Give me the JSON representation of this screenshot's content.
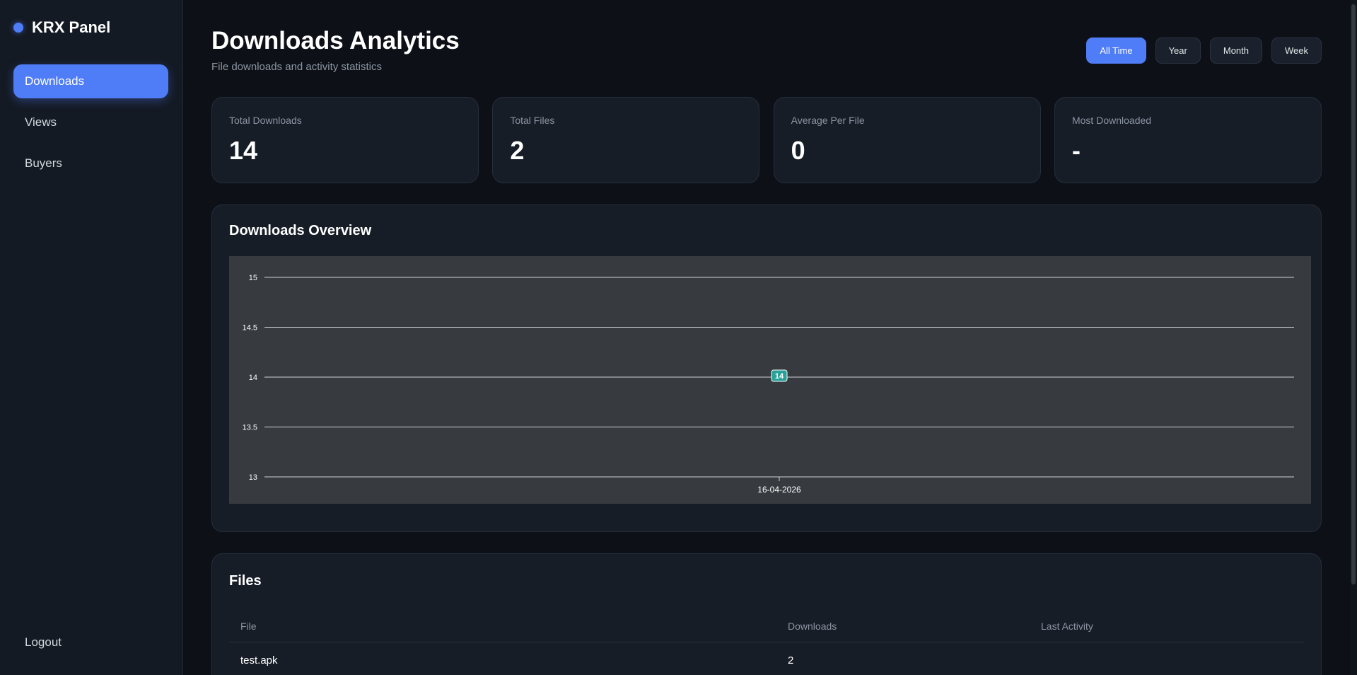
{
  "brand": {
    "title": "KRX Panel",
    "accent": "#4f7cf7"
  },
  "sidebar": {
    "items": [
      {
        "label": "Downloads",
        "active": true
      },
      {
        "label": "Views",
        "active": false
      },
      {
        "label": "Buyers",
        "active": false
      }
    ],
    "logout_label": "Logout"
  },
  "header": {
    "title": "Downloads Analytics",
    "subtitle": "File downloads and activity statistics",
    "filters": [
      "All Time",
      "Year",
      "Month",
      "Week"
    ],
    "active_filter": "All Time"
  },
  "stats": [
    {
      "label": "Total Downloads",
      "value": "14"
    },
    {
      "label": "Total Files",
      "value": "2"
    },
    {
      "label": "Average Per File",
      "value": "0"
    },
    {
      "label": "Most Downloaded",
      "value": "-"
    }
  ],
  "overview": {
    "title": "Downloads Overview"
  },
  "chart_data": {
    "type": "line",
    "x": [
      "16-04-2026"
    ],
    "values": [
      14
    ],
    "data_labels": [
      "14"
    ],
    "yticks": [
      "13",
      "13.5",
      "14",
      "14.5",
      "15"
    ],
    "ylim": [
      13,
      15
    ],
    "grid": true,
    "point_color": "#2aa198"
  },
  "files": {
    "title": "Files",
    "columns": [
      "File",
      "Downloads",
      "Last Activity"
    ],
    "rows": [
      {
        "file": "test.apk",
        "downloads": "2",
        "last_activity": ""
      }
    ]
  }
}
